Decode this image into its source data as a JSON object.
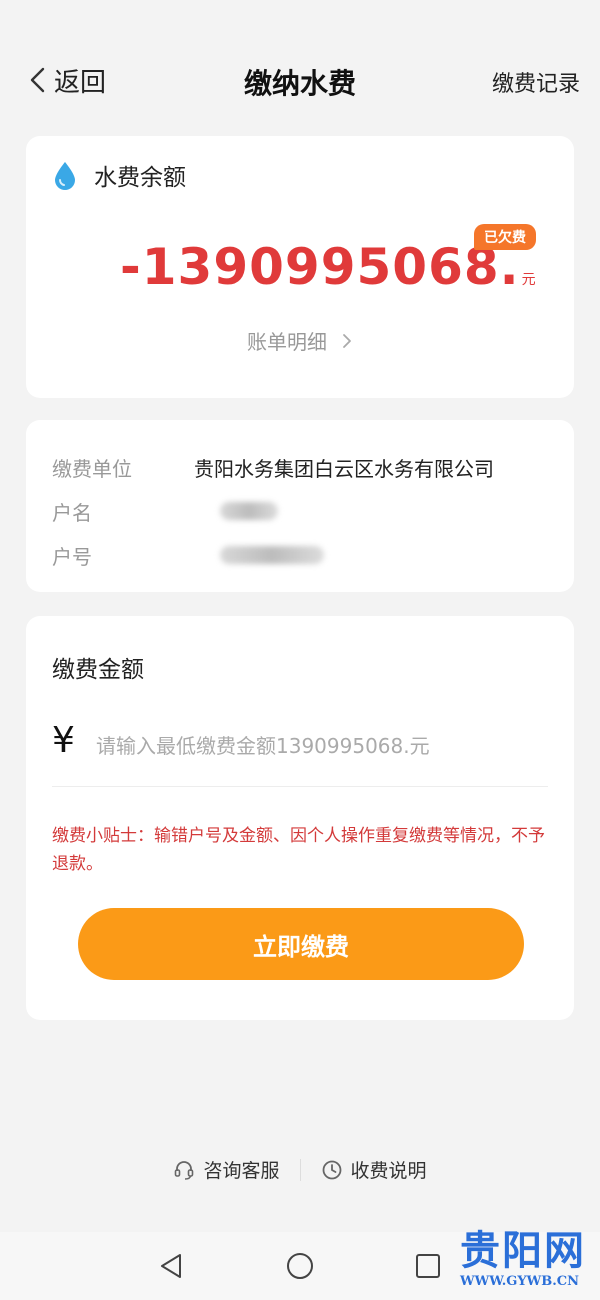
{
  "header": {
    "back_label": "返回",
    "title": "缴纳水费",
    "records_label": "缴费记录"
  },
  "balance": {
    "icon": "water-drop-icon",
    "title": "水费余额",
    "amount": "-1390995068.",
    "unit": "元",
    "badge": "已欠费",
    "detail_link": "账单明细",
    "amount_color": "#e03a3a",
    "badge_color": "#f5762a"
  },
  "info": {
    "rows": [
      {
        "label": "缴费单位",
        "value": "贵阳水务集团白云区水务有限公司"
      },
      {
        "label": "户名",
        "value": ""
      },
      {
        "label": "户号",
        "value": ""
      }
    ]
  },
  "payment": {
    "title": "缴费金额",
    "currency": "¥",
    "value": "",
    "placeholder": "请输入最低缴费金额1390995068.元",
    "tips": "缴费小贴士：输错户号及金额、因个人操作重复缴费等情况，不予退款。",
    "button_label": "立即缴费",
    "button_color": "#fb9a17"
  },
  "footer": {
    "service_label": "咨询客服",
    "service_icon": "headset-icon",
    "fee_label": "收费说明",
    "fee_icon": "clock-icon"
  },
  "watermark": {
    "logo": "贵阳网",
    "url": "WWW.GYWB.CN"
  }
}
